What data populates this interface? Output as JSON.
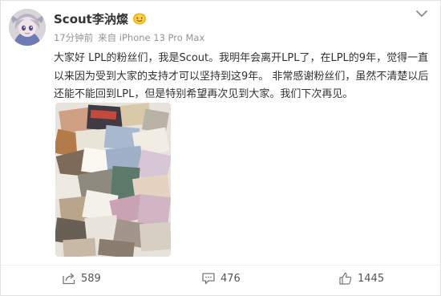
{
  "author": {
    "name": "Scout李汭燦"
  },
  "post": {
    "time": "17分钟前",
    "source": "来自 iPhone 13 Pro Max",
    "text": "大家好 LPL的粉丝们，我是Scout。我明年会离开LPL了，在LPL的9年，觉得一直以来因为受到大家的支持才可以坚持到这9年。 非常感谢粉丝们，虽然不清楚以后还能不能回到LPL，但是特别希望再次见到大家。我们下次再见。"
  },
  "actions": {
    "share_count": "589",
    "comment_count": "476",
    "like_count": "1445"
  },
  "icons": {
    "more": "chevron-down-icon",
    "badge": "emoji-badge-icon",
    "share": "share-icon",
    "comment": "comment-icon",
    "like": "thumbs-up-icon"
  },
  "colors": {
    "text": "#333333",
    "meta": "#939393",
    "badge": "#f2b21c"
  }
}
